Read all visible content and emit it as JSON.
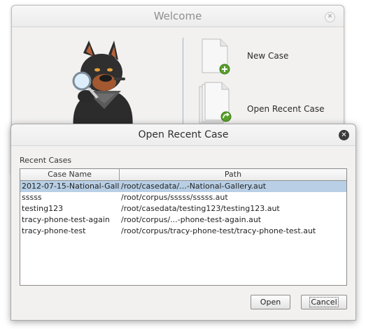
{
  "welcome": {
    "title": "Welcome",
    "close_icon": "close-icon",
    "mascot_icon": "dog-with-magnifier-icon",
    "new_case_label": "New Case",
    "open_recent_label": "Open Recent Case"
  },
  "dialog": {
    "title": "Open Recent Case",
    "close_icon": "close-icon",
    "section_label": "Recent Cases",
    "columns": [
      "Case Name",
      "Path"
    ],
    "rows": [
      {
        "name": "2012-07-15-National-Gall...",
        "path": "/root/casedata/...-National-Gallery.aut",
        "selected": true
      },
      {
        "name": "sssss",
        "path": "/root/corpus/sssss/sssss.aut",
        "selected": false
      },
      {
        "name": "testing123",
        "path": "/root/casedata/testing123/testing123.aut",
        "selected": false
      },
      {
        "name": "tracy-phone-test-again",
        "path": "/root/corpus/...-phone-test-again.aut",
        "selected": false
      },
      {
        "name": "tracy-phone-test",
        "path": "/root/corpus/tracy-phone-test/tracy-phone-test.aut",
        "selected": false
      }
    ],
    "open_label": "Open",
    "cancel_label": "Cancel"
  },
  "colors": {
    "selection": "#b8cfe5",
    "window_bg": "#f2f1f0",
    "accent_green": "#5aa02c"
  }
}
